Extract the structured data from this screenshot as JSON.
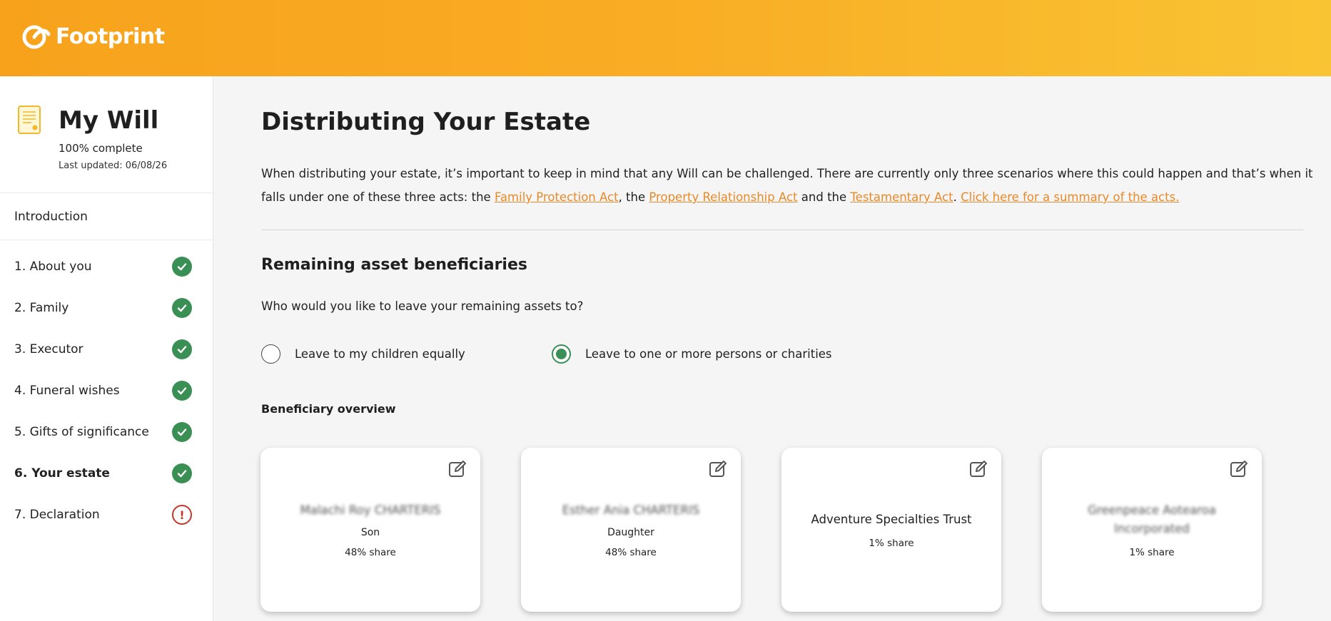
{
  "brand": {
    "name": "Footprint"
  },
  "sidebar": {
    "title": "My Will",
    "progress": "100% complete",
    "updated": "Last updated: 06/08/26",
    "intro_label": "Introduction",
    "steps": [
      {
        "label": "1. About you",
        "status": "complete"
      },
      {
        "label": "2. Family",
        "status": "complete"
      },
      {
        "label": "3. Executor",
        "status": "complete"
      },
      {
        "label": "4. Funeral wishes",
        "status": "complete"
      },
      {
        "label": "5. Gifts of significance",
        "status": "complete"
      },
      {
        "label": "6. Your estate",
        "status": "complete",
        "active": true
      },
      {
        "label": "7. Declaration",
        "status": "incomplete"
      }
    ]
  },
  "main": {
    "title": "Distributing Your Estate",
    "intro": {
      "text1": "When distributing your estate, it’s important to keep in mind that any Will can be challenged. There are currently only three scenarios where this could happen and that’s when it falls under one of these three acts: the ",
      "link1": "Family Protection Act",
      "text2": ", the ",
      "link2": "Property Relationship Act",
      "text3": " and the ",
      "link3": "Testamentary Act",
      "text4": ". ",
      "link4": "Click here for a summary of the acts."
    },
    "section_title": "Remaining asset beneficiaries",
    "question": "Who would you like to leave your remaining assets to?",
    "options": [
      {
        "label": "Leave to my children equally",
        "selected": false
      },
      {
        "label": "Leave to one or more persons or charities",
        "selected": true
      }
    ],
    "overview_title": "Beneficiary overview",
    "beneficiaries": [
      {
        "name": "Malachi Roy CHARTERIS",
        "relation": "Son",
        "share": "48% share",
        "redacted": true
      },
      {
        "name": "Esther Ania CHARTERIS",
        "relation": "Daughter",
        "share": "48% share",
        "redacted": true
      },
      {
        "name": "Adventure Specialties Trust",
        "relation": "",
        "share": "1% share",
        "redacted": false
      },
      {
        "name": "Greenpeace Aotearoa Incorporated",
        "relation": "",
        "share": "1% share",
        "redacted": true
      }
    ]
  },
  "colors": {
    "accent": "#f8a21c",
    "success": "#3a8f55",
    "link": "#e88a2a",
    "error": "#c0392b"
  },
  "icons": {
    "logo": "footprint-logo-icon",
    "doc": "document-icon",
    "check": "check-icon",
    "warning": "exclamation-icon",
    "edit": "edit-icon"
  }
}
